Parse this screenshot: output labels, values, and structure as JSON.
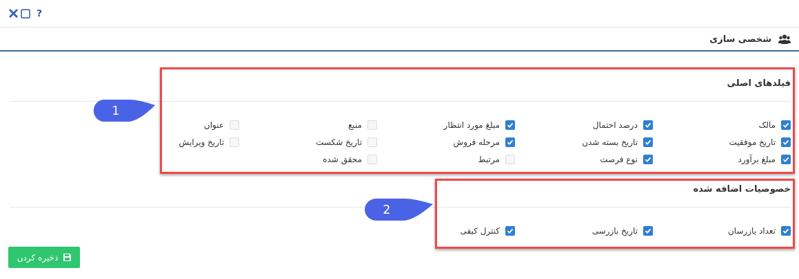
{
  "title_bar": {
    "help": "?"
  },
  "header": {
    "title": "شخصی سازی"
  },
  "sections": [
    {
      "title": "فیلدهای اصلی",
      "fields": [
        {
          "label": "مالک",
          "checked": true
        },
        {
          "label": "درصد احتمال",
          "checked": true
        },
        {
          "label": "مبلغ مورد انتظار",
          "checked": true
        },
        {
          "label": "منبع",
          "checked": false
        },
        {
          "label": "عنوان",
          "checked": false
        },
        {
          "label": "تاریخ موفقیت",
          "checked": true
        },
        {
          "label": "تاریخ بسته شدن",
          "checked": true
        },
        {
          "label": "مرحله فروش",
          "checked": true
        },
        {
          "label": "تاریخ شکست",
          "checked": false
        },
        {
          "label": "تاریخ ویرایش",
          "checked": false
        },
        {
          "label": "مبلغ برآورد",
          "checked": true
        },
        {
          "label": "نوع فرصت",
          "checked": true
        },
        {
          "label": "مرتبط",
          "checked": false
        },
        {
          "label": "محقق شده",
          "checked": false
        }
      ]
    },
    {
      "title": "خصوصیات اضافه شده",
      "fields": [
        {
          "label": "تعداد بازرسان",
          "checked": true
        },
        {
          "label": "تاریخ بازرسی",
          "checked": true
        },
        {
          "label": "کنترل کیفی",
          "checked": true
        }
      ]
    }
  ],
  "save_button": {
    "label": "ذخیره کردن"
  },
  "annotations": [
    {
      "label": "1"
    },
    {
      "label": "2"
    }
  ]
}
